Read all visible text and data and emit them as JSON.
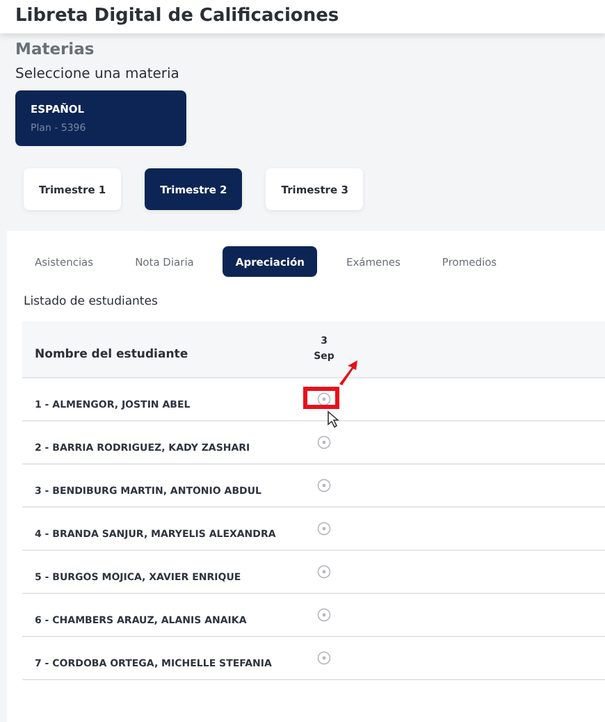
{
  "header": {
    "title": "Libreta Digital de Calificaciones"
  },
  "section_title": "Materias",
  "subject_prompt": "Seleccione una materia",
  "subjects": [
    {
      "name": "ESPAÑOL",
      "plan": "Plan - 5396",
      "selected": true
    }
  ],
  "terms": [
    {
      "label": "Trimestre 1",
      "selected": false
    },
    {
      "label": "Trimestre 2",
      "selected": true
    },
    {
      "label": "Trimestre 3",
      "selected": false
    }
  ],
  "tabs": [
    {
      "label": "Asistencias",
      "selected": false
    },
    {
      "label": "Nota Diaria",
      "selected": false
    },
    {
      "label": "Apreciación",
      "selected": true
    },
    {
      "label": "Exámenes",
      "selected": false
    },
    {
      "label": "Promedios",
      "selected": false
    }
  ],
  "list_title": "Listado de estudiantes",
  "table": {
    "columns": [
      {
        "label": "Nombre del estudiante"
      },
      {
        "day": "3",
        "month": "Sep"
      }
    ],
    "rows": [
      {
        "name": "1 - ALMENGOR, JOSTIN ABEL",
        "highlighted": true
      },
      {
        "name": "2 - BARRIA RODRIGUEZ, KADY ZASHARI",
        "highlighted": false
      },
      {
        "name": "3 - BENDIBURG MARTIN, ANTONIO ABDUL",
        "highlighted": false
      },
      {
        "name": "4 - BRANDA SANJUR, MARYELIS ALEXANDRA",
        "highlighted": false
      },
      {
        "name": "5 - BURGOS MOJICA, XAVIER ENRIQUE",
        "highlighted": false
      },
      {
        "name": "6 - CHAMBERS ARAUZ, ALANIS ANAIKA",
        "highlighted": false
      },
      {
        "name": "7 - CORDOBA ORTEGA, MICHELLE STEFANIA",
        "highlighted": false
      }
    ]
  }
}
